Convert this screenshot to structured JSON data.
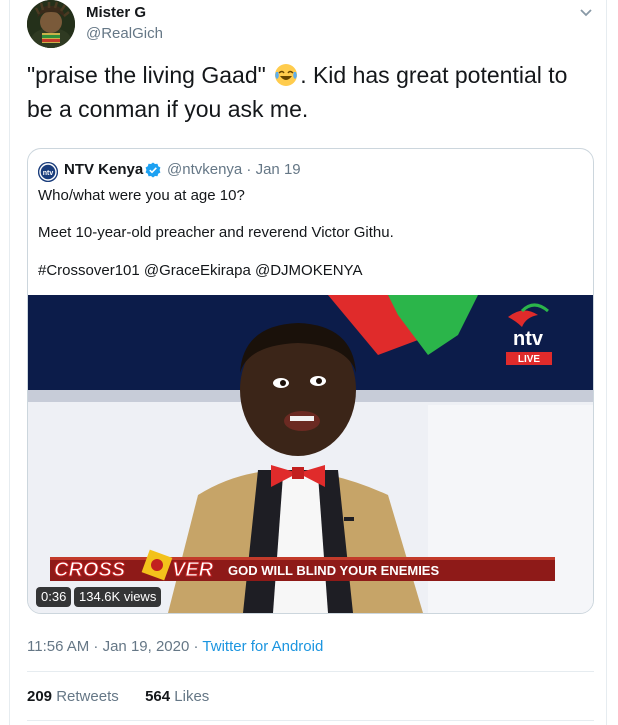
{
  "tweet": {
    "author_name": "Mister G",
    "author_handle": "@RealGich",
    "text_part1": "\"praise the living Gaad\"",
    "text_part2": ". Kid has great potential to be a conman if you ask me.",
    "emoji": "face-with-tears-of-joy",
    "timestamp": "11:56 AM · Jan 19, 2020 · ",
    "source": "Twitter for Android",
    "retweets_count": "209",
    "retweets_label": "Retweets",
    "likes_count": "564",
    "likes_label": "Likes"
  },
  "quoted": {
    "author_name": "NTV Kenya",
    "meta": "@ntvkenya · Jan 19",
    "line1": "Who/what were you at age 10?",
    "line2": "Meet 10-year-old preacher and reverend Victor Githu.",
    "line3": "#Crossover101 @GraceEkirapa @DJMOKENYA",
    "video": {
      "duration": "0:36",
      "views": "134.6K views",
      "channel_logo_text": "ntv",
      "live_label": "LIVE",
      "show_logo_part1": "CROSS",
      "show_logo_part2": "VER",
      "ticker_text": "GOD WILL BLIND YOUR ENEMIES"
    }
  },
  "colors": {
    "link": "#1b95e0",
    "secondary_text": "#657786",
    "verified": "#1da1f2",
    "bowtie": "#e02b2b"
  }
}
